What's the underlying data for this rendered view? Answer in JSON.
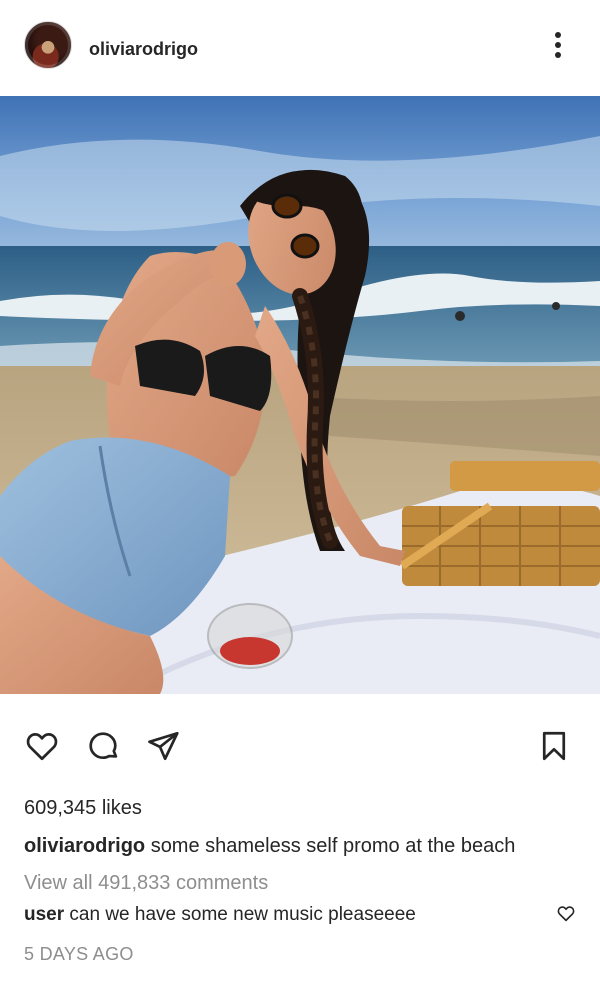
{
  "post": {
    "author": "oliviarodrigo",
    "avatar_icon": "profile-avatar",
    "more_icon": "more-options-icon",
    "photo_description_icon": "post-image",
    "likes_text": "609,345 likes",
    "caption": {
      "username": "oliviarodrigo",
      "text": "some shameless self promo at the beach"
    },
    "view_all_comments": "View all 491,833 comments",
    "comment": {
      "username": "user",
      "text": "can we have some new music pleaseeee"
    },
    "timestamp": "5 DAYS AGO"
  },
  "icons": {
    "like": "heart-icon",
    "comment": "comment-icon",
    "share": "share-icon",
    "save": "bookmark-icon",
    "comment_like": "heart-icon"
  },
  "colors": {
    "text": "#262626",
    "muted": "#8e8e8e",
    "background": "#ffffff"
  }
}
